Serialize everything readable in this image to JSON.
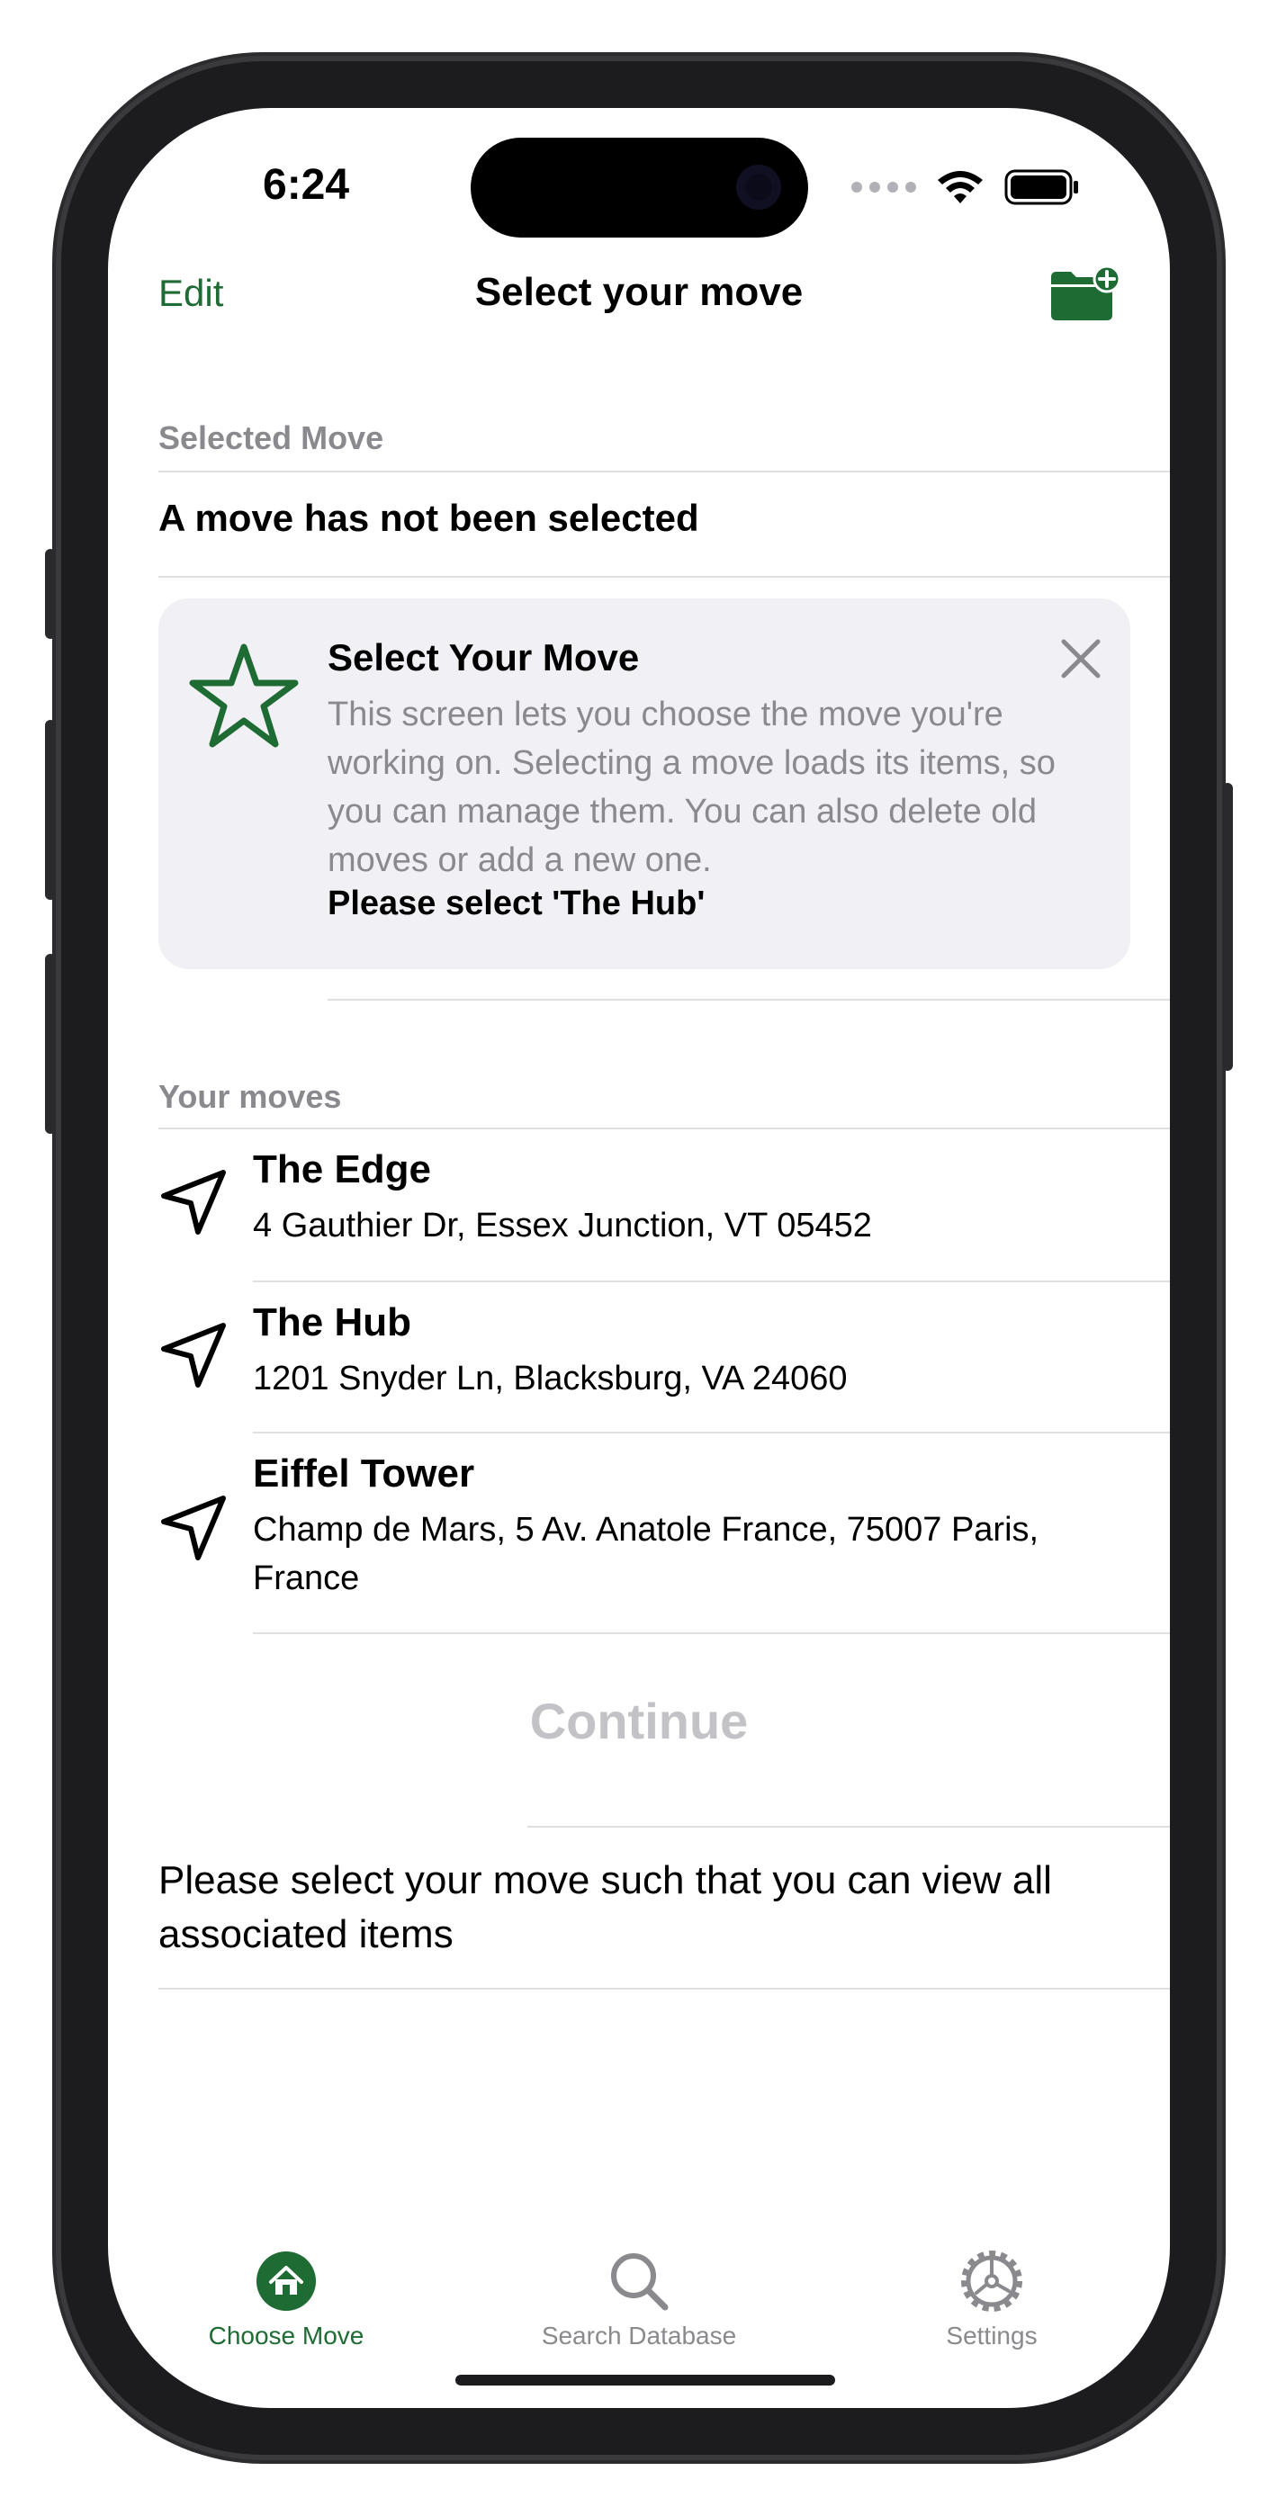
{
  "status_bar": {
    "time": "6:24"
  },
  "nav": {
    "edit_label": "Edit",
    "title": "Select your move",
    "add_icon": "folder-add-icon"
  },
  "selected_section": {
    "header": "Selected Move",
    "value": "A move has not been selected"
  },
  "tip": {
    "icon": "star-icon",
    "title": "Select Your Move",
    "body": "This screen lets you choose the move you're working on. Selecting a move loads its items, so you can manage them. You can also delete old moves or add a new one.",
    "strong": "Please select 'The Hub'"
  },
  "moves_section": {
    "header": "Your moves",
    "items": [
      {
        "name": "The Edge",
        "address": "4 Gauthier Dr, Essex Junction, VT 05452"
      },
      {
        "name": "The Hub",
        "address": "1201 Snyder Ln, Blacksburg, VA 24060"
      },
      {
        "name": "Eiffel Tower",
        "address": "Champ de Mars, 5 Av. Anatole France, 75007 Paris, France"
      }
    ]
  },
  "continue_label": "Continue",
  "note": "Please select your move such that you can view all associated items",
  "tabbar": {
    "tabs": [
      {
        "label": "Choose Move",
        "icon": "home-icon",
        "selected": true
      },
      {
        "label": "Search Database",
        "icon": "search-icon",
        "selected": false
      },
      {
        "label": "Settings",
        "icon": "gear-icon",
        "selected": false
      }
    ]
  },
  "colors": {
    "accent": "#1e6b34",
    "secondary_text": "#8a8a8e",
    "card_bg": "#f1f1f5",
    "disabled": "#c3c3c7"
  }
}
